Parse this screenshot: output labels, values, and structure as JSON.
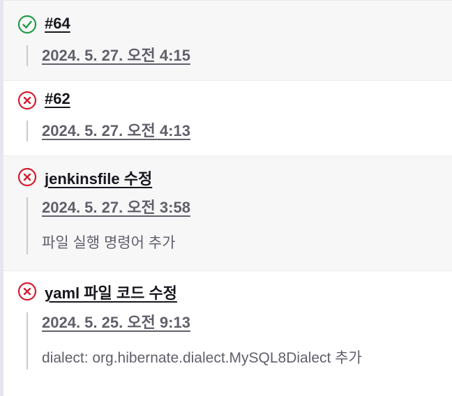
{
  "colors": {
    "success": "#1e9e47",
    "failure": "#d21d2e",
    "text": "#16161d",
    "muted": "#60606a"
  },
  "builds": [
    {
      "status": "success",
      "status_icon": "check-circle-icon",
      "title": "#64",
      "timestamp": "2024. 5. 27. 오전 4:15",
      "message": ""
    },
    {
      "status": "failure",
      "status_icon": "x-circle-icon",
      "title": "#62",
      "timestamp": "2024. 5. 27. 오전 4:13",
      "message": ""
    },
    {
      "status": "failure",
      "status_icon": "x-circle-icon",
      "title": "jenkinsfile 수정",
      "timestamp": "2024. 5. 27. 오전 3:58",
      "message": "파일 실행 명령어 추가"
    },
    {
      "status": "failure",
      "status_icon": "x-circle-icon",
      "title": "yaml 파일 코드 수정",
      "timestamp": "2024. 5. 25. 오전 9:13",
      "message": "dialect: org.hibernate.dialect.MySQL8Dialect 추가"
    }
  ]
}
